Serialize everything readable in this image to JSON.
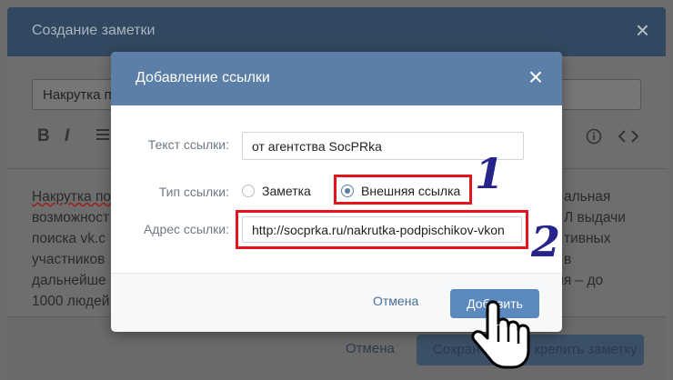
{
  "background_editor": {
    "title": "Создание заметки",
    "close_icon": "close-icon",
    "note_title_value": "Накрутка п",
    "toolbar": {
      "bold_icon": "B",
      "italic_icon": "I",
      "list_icon": "list-icon",
      "info_icon": "info-icon",
      "code_icon": "code-icon"
    },
    "body_lines_left": [
      "Накрутка по",
      "возможност",
      "поиска vk.c",
      "участников",
      "дальнейше",
      "1000 людей"
    ],
    "body_lines_right": [
      "альная",
      "Л выдачи",
      "тивных",
      "в",
      "ения – до",
      ""
    ],
    "footer": {
      "cancel_label": "Отмена",
      "save_label": "Сохранить и закрепить заметку",
      "save_visible_left": "Сохран",
      "save_visible_right": "крепить заметку"
    }
  },
  "dialog": {
    "title": "Добавление ссылки",
    "close_icon": "close-icon",
    "link_text": {
      "label": "Текст ссылки:",
      "value": "от агентства SocPRka"
    },
    "link_type": {
      "label": "Тип ссылки:",
      "options": [
        {
          "label": "Заметка",
          "checked": false
        },
        {
          "label": "Внешняя ссылка",
          "checked": true
        }
      ]
    },
    "link_address": {
      "label": "Адрес ссылки:",
      "value": "http://socprka.ru/nakrutka-podpischikov-vkon"
    },
    "footer": {
      "cancel_label": "Отмена",
      "add_label": "Добавить"
    }
  },
  "annotations": {
    "marker_1": "1",
    "marker_2": "2",
    "highlight_color": "#e3141b",
    "marker_color": "#24248a",
    "cursor_icon": "hand-pointer-icon"
  },
  "colors": {
    "dialog_header": "#5b7fa6",
    "primary_button": "#5b88bd",
    "link_text": "#4a6e95"
  }
}
